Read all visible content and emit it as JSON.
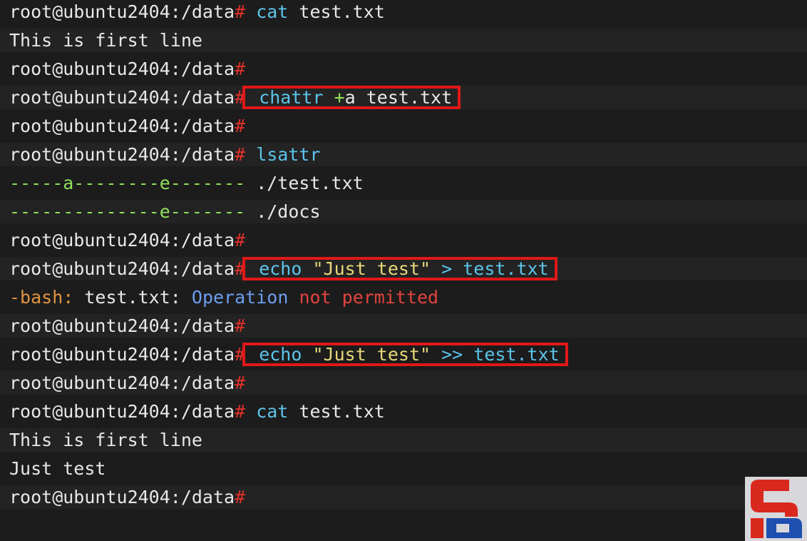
{
  "prompt": "root@ubuntu2404:/data",
  "prompt_hash": "#",
  "lines": {
    "l1_cmd": "cat",
    "l1_arg": "test.txt",
    "l2_out": "This is first line",
    "l4_cmd_a": "chattr",
    "l4_cmd_b": "+",
    "l4_cmd_c": "a test.txt",
    "l6_cmd": "lsattr",
    "l7_attr": "-----a--------e-------",
    "l7_file": "./test.txt",
    "l8_attr": "--------------e-------",
    "l8_file": "./docs",
    "l10_echo": "echo",
    "l10_str": "\"Just test\"",
    "l10_op": ">",
    "l10_file": "test.txt",
    "l11_a": "-bash:",
    "l11_b": "test.txt:",
    "l11_c": "Operation",
    "l11_d": "not permitted",
    "l13_echo": "echo",
    "l13_str": "\"Just test\"",
    "l13_op": ">>",
    "l13_file": "test.txt",
    "l15_cmd": "cat",
    "l15_arg": "test.txt",
    "l16_out": "This is first line",
    "l17_out": "Just test"
  },
  "colors": {
    "background": "#1c1c1c",
    "highlight_box": "#e01818",
    "prompt_hash": "#e0302a",
    "command": "#5cc4ea"
  },
  "logo": {
    "icon": "sb-logo-icon"
  }
}
